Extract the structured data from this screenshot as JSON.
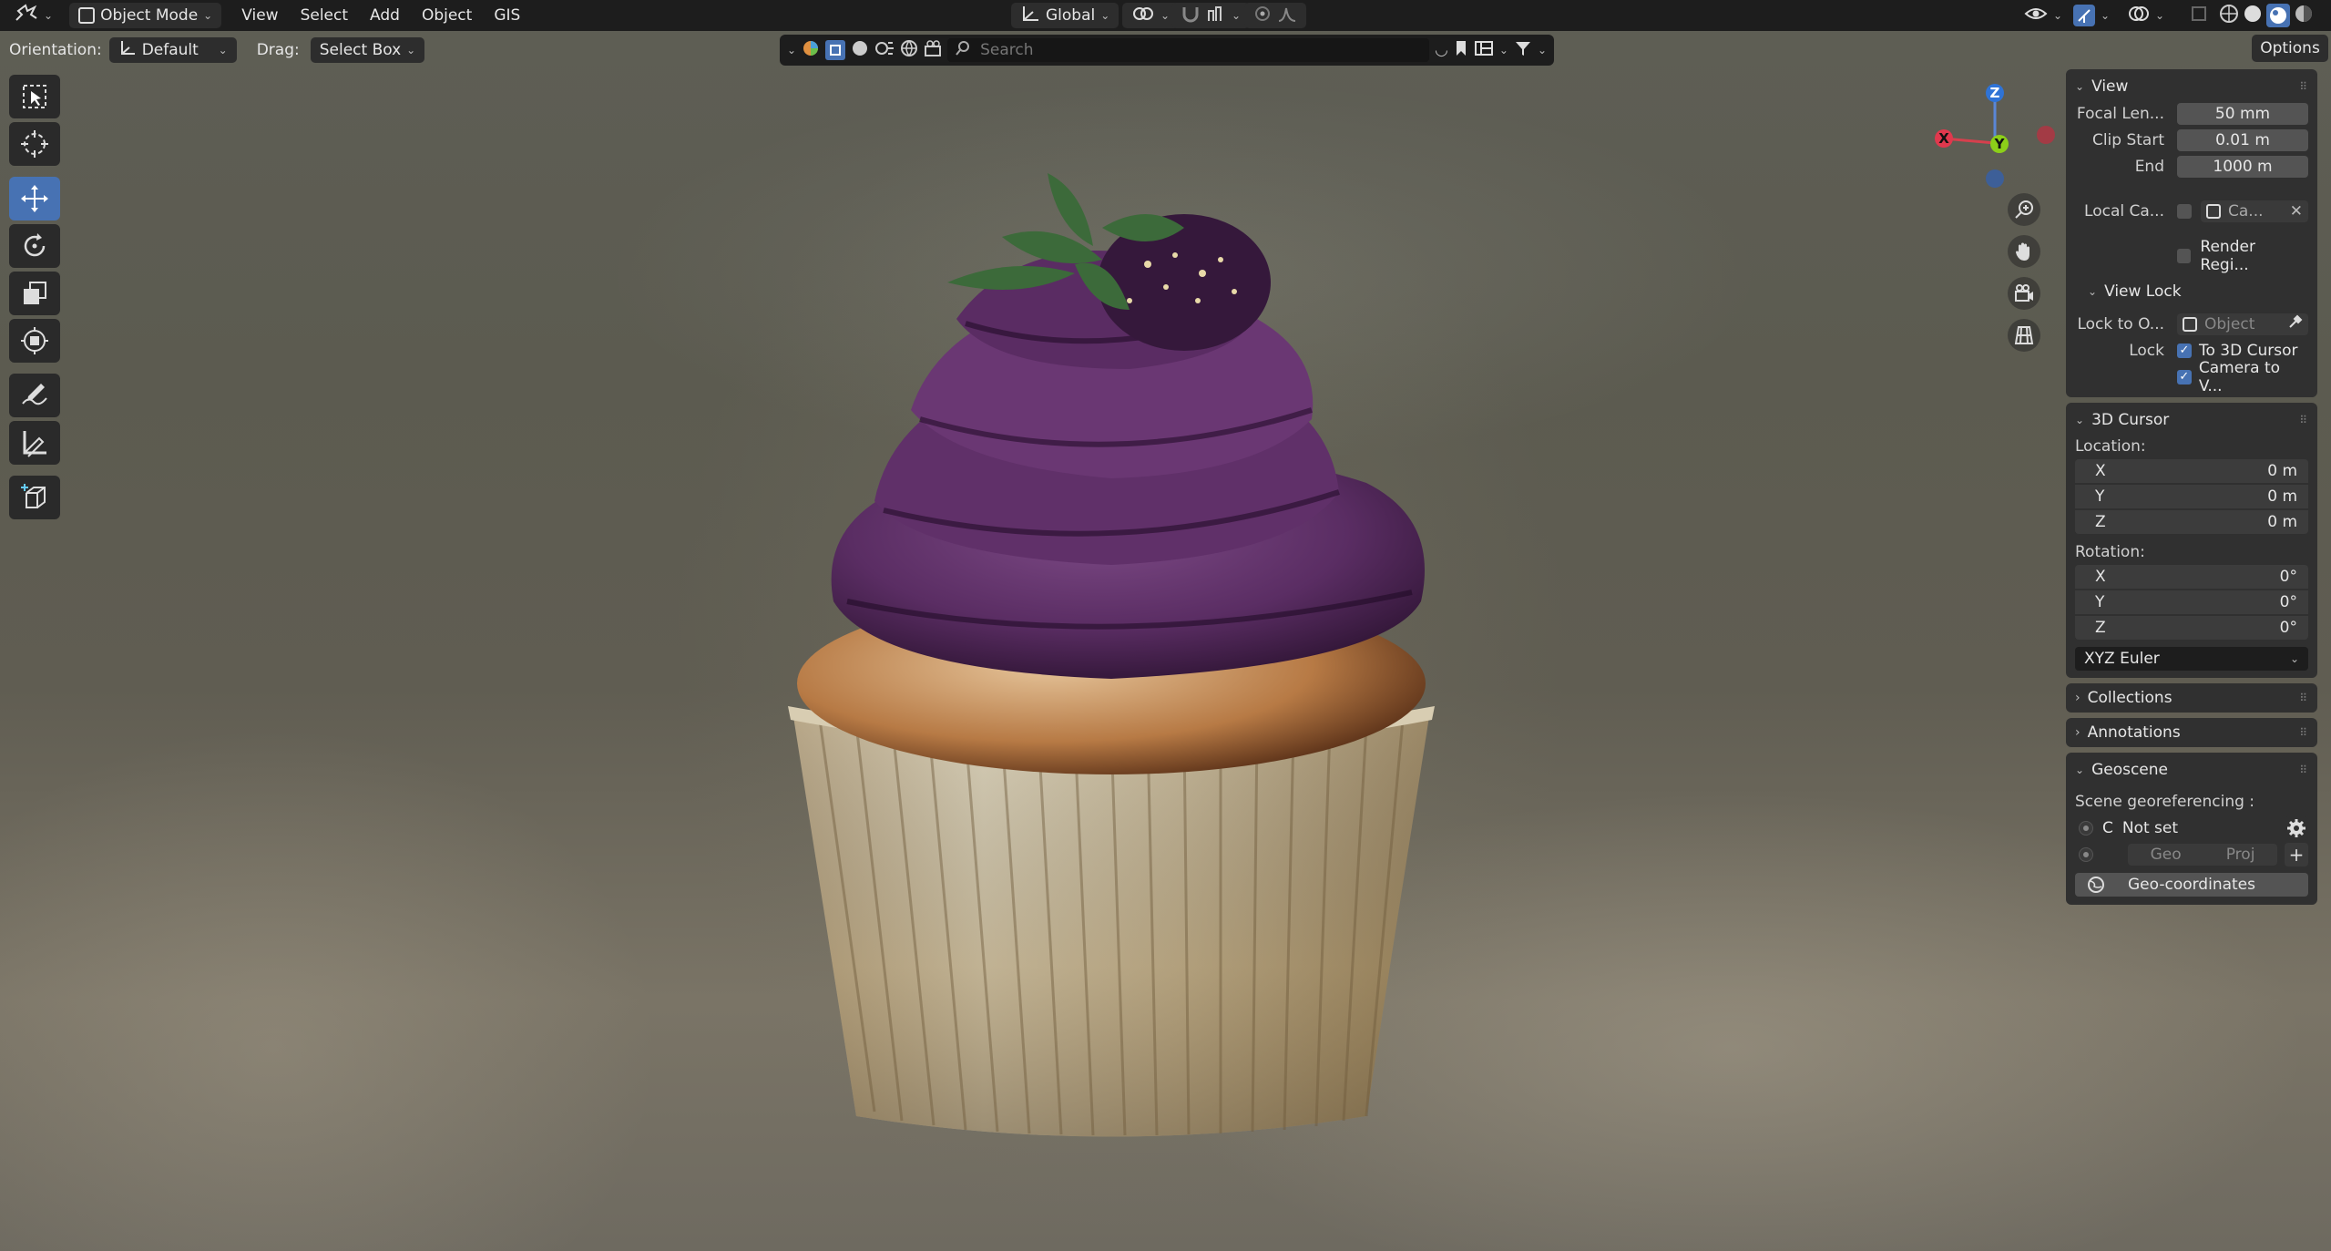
{
  "header": {
    "mode": "Object Mode",
    "menus": [
      "View",
      "Select",
      "Add",
      "Object",
      "GIS"
    ],
    "transform_orientation": "Global"
  },
  "toolheader": {
    "orientation_label": "Orientation:",
    "orientation_value": "Default",
    "drag_label": "Drag:",
    "drag_value": "Select Box",
    "search_placeholder": "Search",
    "options_label": "Options"
  },
  "gizmo": {
    "x": "X",
    "y": "Y",
    "z": "Z"
  },
  "sidebar": {
    "view": {
      "title": "View",
      "focal_length_label": "Focal Len...",
      "focal_length_value": "50 mm",
      "clip_start_label": "Clip Start",
      "clip_start_value": "0.01 m",
      "clip_end_label": "End",
      "clip_end_value": "1000 m",
      "local_camera_label": "Local Ca...",
      "local_camera_value": "Ca...",
      "render_region_label": "Render Regi...",
      "view_lock_title": "View Lock",
      "lock_to_object_label": "Lock to O...",
      "lock_to_object_placeholder": "Object",
      "lock_label": "Lock",
      "to_3d_cursor_label": "To 3D Cursor",
      "camera_to_view_label": "Camera to V..."
    },
    "cursor": {
      "title": "3D Cursor",
      "location_label": "Location:",
      "location": [
        {
          "axis": "X",
          "value": "0 m"
        },
        {
          "axis": "Y",
          "value": "0 m"
        },
        {
          "axis": "Z",
          "value": "0 m"
        }
      ],
      "rotation_label": "Rotation:",
      "rotation": [
        {
          "axis": "X",
          "value": "0°"
        },
        {
          "axis": "Y",
          "value": "0°"
        },
        {
          "axis": "Z",
          "value": "0°"
        }
      ],
      "rotation_mode": "XYZ Euler"
    },
    "collections_title": "Collections",
    "annotations_title": "Annotations",
    "geoscene": {
      "title": "Geoscene",
      "georef_label": "Scene georeferencing :",
      "crs_letter": "C",
      "crs_status": "Not set",
      "geo_label": "Geo",
      "proj_label": "Proj",
      "geo_coordinates_label": "Geo-coordinates"
    }
  }
}
